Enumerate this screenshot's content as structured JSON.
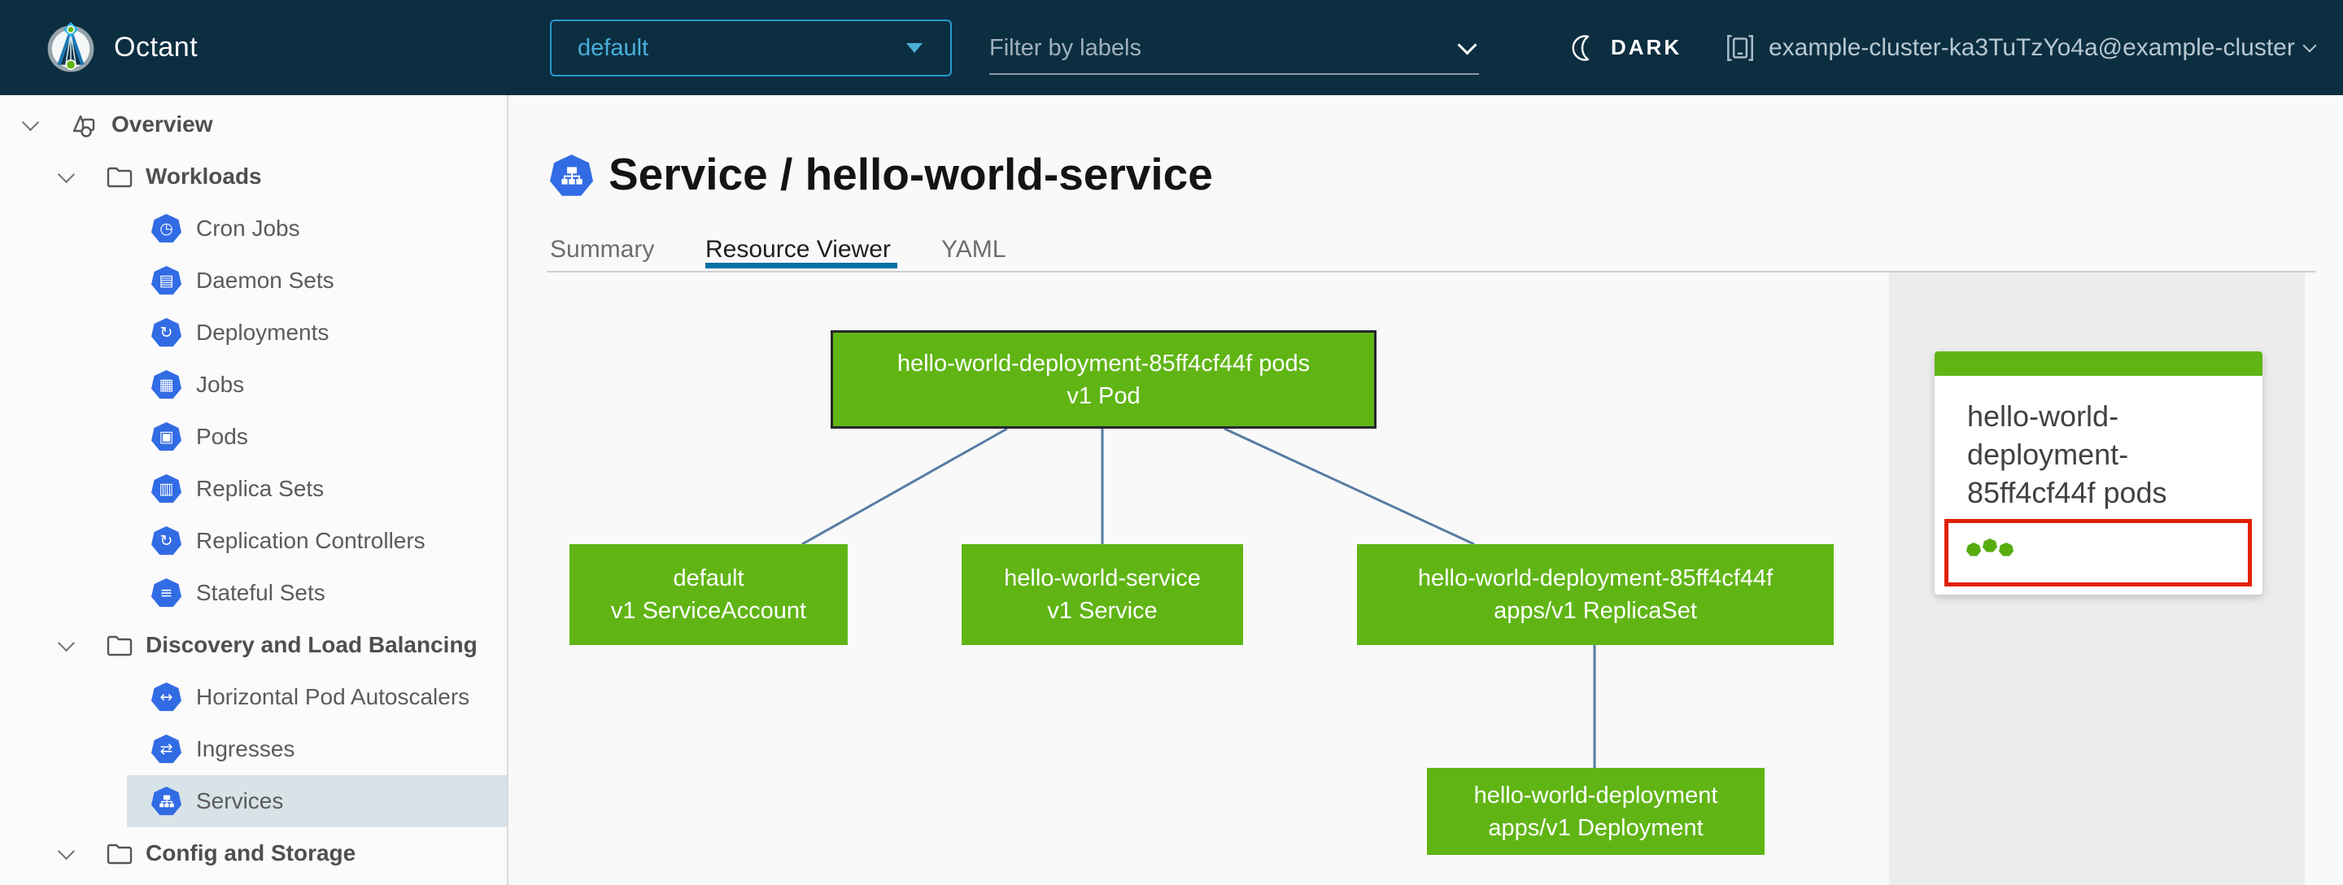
{
  "topbar": {
    "app_name": "Octant",
    "namespace": {
      "value": "default"
    },
    "filter": {
      "placeholder": "Filter by labels",
      "value": ""
    },
    "theme_toggle_label": "DARK",
    "context": {
      "name": "example-cluster-ka3TuTzYo4a@example-cluster"
    }
  },
  "sidebar": {
    "items": [
      {
        "label": "Overview",
        "type": "root",
        "expanded": true
      },
      {
        "label": "Workloads",
        "type": "group",
        "expanded": true
      },
      {
        "label": "Cron Jobs",
        "type": "leaf",
        "glyph": "◷"
      },
      {
        "label": "Daemon Sets",
        "type": "leaf",
        "glyph": "▤"
      },
      {
        "label": "Deployments",
        "type": "leaf",
        "glyph": "↻"
      },
      {
        "label": "Jobs",
        "type": "leaf",
        "glyph": "▦"
      },
      {
        "label": "Pods",
        "type": "leaf",
        "glyph": "▣"
      },
      {
        "label": "Replica Sets",
        "type": "leaf",
        "glyph": "▥"
      },
      {
        "label": "Replication Controllers",
        "type": "leaf",
        "glyph": "↻"
      },
      {
        "label": "Stateful Sets",
        "type": "leaf",
        "glyph": "≡"
      },
      {
        "label": "Discovery and Load Balancing",
        "type": "group",
        "expanded": true
      },
      {
        "label": "Horizontal Pod Autoscalers",
        "type": "leaf",
        "glyph": "↔"
      },
      {
        "label": "Ingresses",
        "type": "leaf",
        "glyph": "⇄"
      },
      {
        "label": "Services",
        "type": "leaf",
        "glyph": "",
        "selected": true
      },
      {
        "label": "Config and Storage",
        "type": "group",
        "expanded": true
      }
    ]
  },
  "header": {
    "title": "Service / hello-world-service",
    "tabs": [
      {
        "label": "Summary",
        "active": false
      },
      {
        "label": "Resource Viewer",
        "active": true
      },
      {
        "label": "YAML",
        "active": false
      }
    ]
  },
  "graph": {
    "nodes": [
      {
        "id": "pod",
        "line1": "hello-world-deployment-85ff4cf44f pods",
        "line2": "v1 Pod",
        "selected": true
      },
      {
        "id": "serviceaccount",
        "line1": "default",
        "line2": "v1 ServiceAccount",
        "selected": false
      },
      {
        "id": "service",
        "line1": "hello-world-service",
        "line2": "v1 Service",
        "selected": false
      },
      {
        "id": "replicaset",
        "line1": "hello-world-deployment-85ff4cf44f",
        "line2": "apps/v1 ReplicaSet",
        "selected": false
      },
      {
        "id": "deployment",
        "line1": "hello-world-deployment",
        "line2": "apps/v1 Deployment",
        "selected": false
      }
    ],
    "edges": [
      [
        "pod",
        "serviceaccount"
      ],
      [
        "pod",
        "service"
      ],
      [
        "pod",
        "replicaset"
      ],
      [
        "replicaset",
        "deployment"
      ]
    ]
  },
  "panel": {
    "card": {
      "title": "hello-world-deployment-85ff4cf44f pods",
      "status_dots": 3
    }
  },
  "colors": {
    "header_bg": "#0c2e41",
    "accent_blue": "#49afd9",
    "k8s_blue": "#326ce5",
    "node_green": "#60b515",
    "selection_red": "#e12200",
    "edge_blue": "#587ca5",
    "tab_active_blue": "#0072a3",
    "sidebar_selected_bg": "#d8e3e8"
  }
}
